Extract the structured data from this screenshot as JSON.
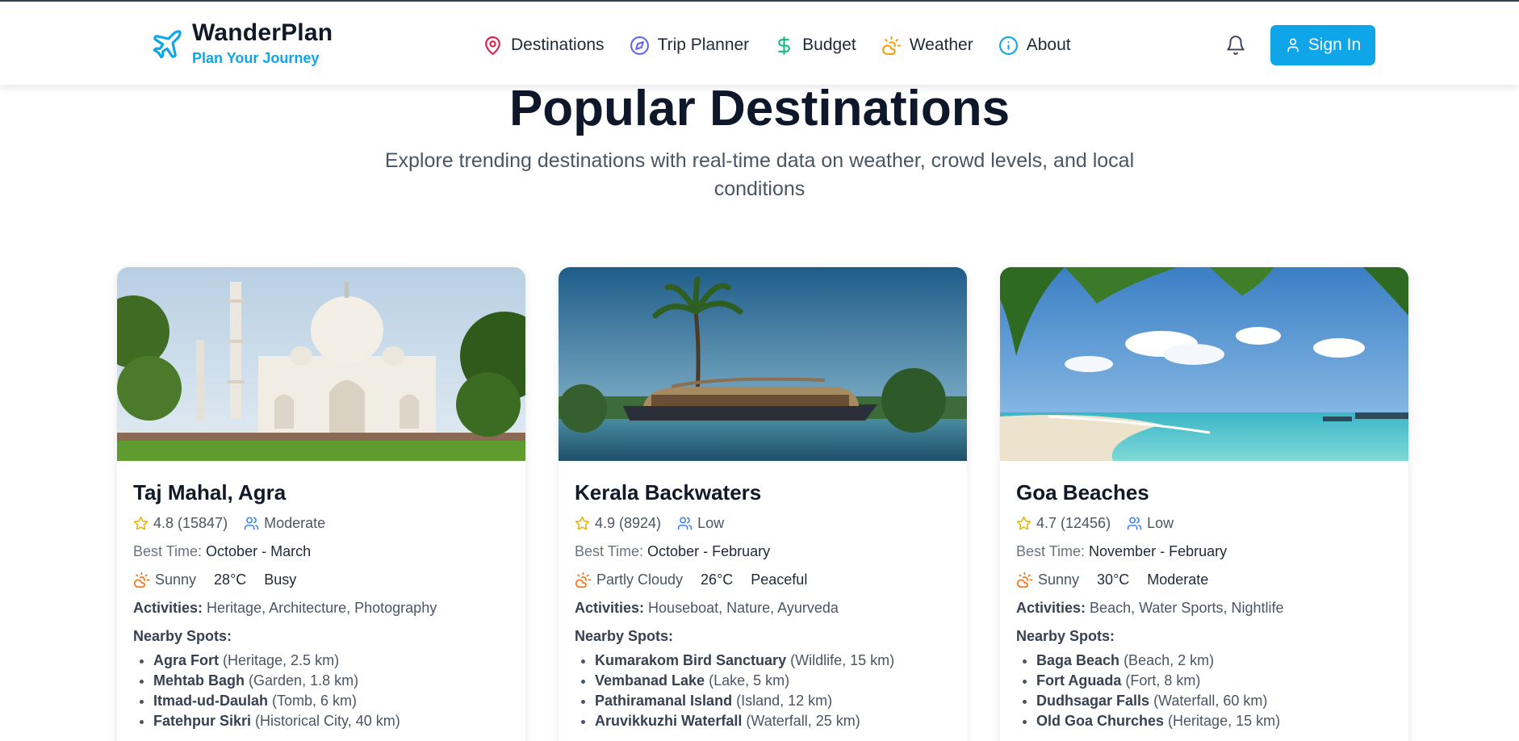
{
  "brand": {
    "name": "WanderPlan",
    "tagline": "Plan Your Journey"
  },
  "nav": {
    "items": [
      {
        "label": "Destinations",
        "icon": "map-pin-icon",
        "color": "#e11d48"
      },
      {
        "label": "Trip Planner",
        "icon": "compass-icon",
        "color": "#6366f1"
      },
      {
        "label": "Budget",
        "icon": "dollar-icon",
        "color": "#10b981"
      },
      {
        "label": "Weather",
        "icon": "sun-cloud-icon",
        "color": "#f59e0b"
      },
      {
        "label": "About",
        "icon": "info-icon",
        "color": "#0ea5e9"
      }
    ],
    "signin_label": "Sign In"
  },
  "hero": {
    "title": "Popular Destinations",
    "subtitle": "Explore trending destinations with real-time data on weather, crowd levels, and local conditions"
  },
  "labels": {
    "best_time": "Best Time:",
    "activities": "Activities:",
    "nearby": "Nearby Spots:"
  },
  "cards": [
    {
      "title": "Taj Mahal, Agra",
      "rating": "4.8 (15847)",
      "crowd": "Moderate",
      "best_time": "October - March",
      "weather": "Sunny",
      "temp": "28°C",
      "level": "Busy",
      "activities": "Heritage, Architecture, Photography",
      "spots": [
        {
          "name": "Agra Fort",
          "detail": "(Heritage, 2.5 km)"
        },
        {
          "name": "Mehtab Bagh",
          "detail": "(Garden, 1.8 km)"
        },
        {
          "name": "Itmad-ud-Daulah",
          "detail": "(Tomb, 6 km)"
        },
        {
          "name": "Fatehpur Sikri",
          "detail": "(Historical City, 40 km)"
        }
      ]
    },
    {
      "title": "Kerala Backwaters",
      "rating": "4.9 (8924)",
      "crowd": "Low",
      "best_time": "October - February",
      "weather": "Partly Cloudy",
      "temp": "26°C",
      "level": "Peaceful",
      "activities": "Houseboat, Nature, Ayurveda",
      "spots": [
        {
          "name": "Kumarakom Bird Sanctuary",
          "detail": "(Wildlife, 15 km)"
        },
        {
          "name": "Vembanad Lake",
          "detail": "(Lake, 5 km)"
        },
        {
          "name": "Pathiramanal Island",
          "detail": "(Island, 12 km)"
        },
        {
          "name": "Aruvikkuzhi Waterfall",
          "detail": "(Waterfall, 25 km)"
        }
      ]
    },
    {
      "title": "Goa Beaches",
      "rating": "4.7 (12456)",
      "crowd": "Low",
      "best_time": "November - February",
      "weather": "Sunny",
      "temp": "30°C",
      "level": "Moderate",
      "activities": "Beach, Water Sports, Nightlife",
      "spots": [
        {
          "name": "Baga Beach",
          "detail": "(Beach, 2 km)"
        },
        {
          "name": "Fort Aguada",
          "detail": "(Fort, 8 km)"
        },
        {
          "name": "Dudhsagar Falls",
          "detail": "(Waterfall, 60 km)"
        },
        {
          "name": "Old Goa Churches",
          "detail": "(Heritage, 15 km)"
        }
      ]
    }
  ]
}
